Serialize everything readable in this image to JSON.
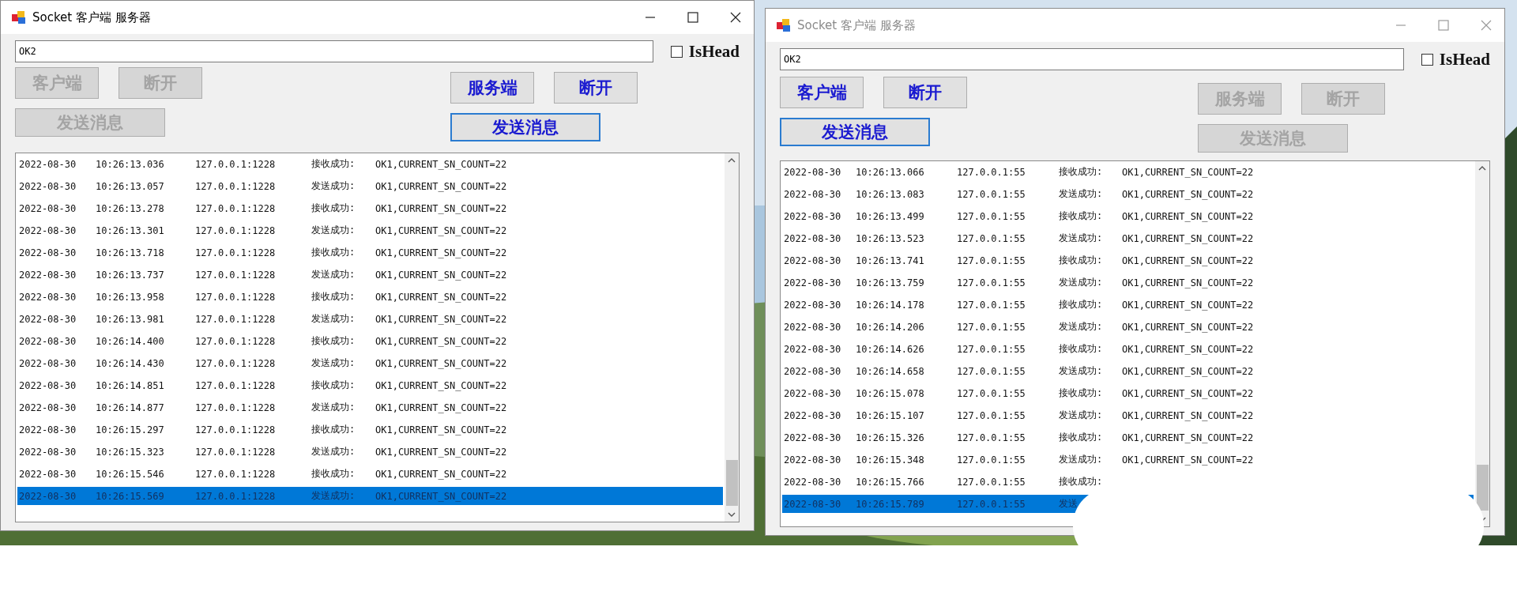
{
  "windows": [
    {
      "title": "Socket 客户端 服务器",
      "active": true,
      "input": {
        "value": "OK2"
      },
      "is_head": {
        "label": "IsHead",
        "checked": false
      },
      "client_buttons": [
        {
          "label": "客户端",
          "disabled": true,
          "focused": false
        },
        {
          "label": "断开",
          "disabled": true,
          "focused": false
        },
        {
          "label": "发送消息",
          "disabled": true,
          "focused": false
        }
      ],
      "server_buttons": [
        {
          "label": "服务端",
          "disabled": false,
          "focused": false
        },
        {
          "label": "断开",
          "disabled": false,
          "focused": false
        },
        {
          "label": "发送消息",
          "disabled": false,
          "focused": true
        }
      ],
      "log": {
        "rows": [
          {
            "cells": [
              "2022-08-30",
              "10:26:13.036",
              "127.0.0.1:1228",
              "接收成功:",
              "OK1,CURRENT_SN_COUNT=22"
            ],
            "selected": false
          },
          {
            "cells": [
              "2022-08-30",
              "10:26:13.057",
              "127.0.0.1:1228",
              "发送成功:",
              "OK1,CURRENT_SN_COUNT=22"
            ],
            "selected": false
          },
          {
            "cells": [
              "2022-08-30",
              "10:26:13.278",
              "127.0.0.1:1228",
              "接收成功:",
              "OK1,CURRENT_SN_COUNT=22"
            ],
            "selected": false
          },
          {
            "cells": [
              "2022-08-30",
              "10:26:13.301",
              "127.0.0.1:1228",
              "发送成功:",
              "OK1,CURRENT_SN_COUNT=22"
            ],
            "selected": false
          },
          {
            "cells": [
              "2022-08-30",
              "10:26:13.718",
              "127.0.0.1:1228",
              "接收成功:",
              "OK1,CURRENT_SN_COUNT=22"
            ],
            "selected": false
          },
          {
            "cells": [
              "2022-08-30",
              "10:26:13.737",
              "127.0.0.1:1228",
              "发送成功:",
              "OK1,CURRENT_SN_COUNT=22"
            ],
            "selected": false
          },
          {
            "cells": [
              "2022-08-30",
              "10:26:13.958",
              "127.0.0.1:1228",
              "接收成功:",
              "OK1,CURRENT_SN_COUNT=22"
            ],
            "selected": false
          },
          {
            "cells": [
              "2022-08-30",
              "10:26:13.981",
              "127.0.0.1:1228",
              "发送成功:",
              "OK1,CURRENT_SN_COUNT=22"
            ],
            "selected": false
          },
          {
            "cells": [
              "2022-08-30",
              "10:26:14.400",
              "127.0.0.1:1228",
              "接收成功:",
              "OK1,CURRENT_SN_COUNT=22"
            ],
            "selected": false
          },
          {
            "cells": [
              "2022-08-30",
              "10:26:14.430",
              "127.0.0.1:1228",
              "发送成功:",
              "OK1,CURRENT_SN_COUNT=22"
            ],
            "selected": false
          },
          {
            "cells": [
              "2022-08-30",
              "10:26:14.851",
              "127.0.0.1:1228",
              "接收成功:",
              "OK1,CURRENT_SN_COUNT=22"
            ],
            "selected": false
          },
          {
            "cells": [
              "2022-08-30",
              "10:26:14.877",
              "127.0.0.1:1228",
              "发送成功:",
              "OK1,CURRENT_SN_COUNT=22"
            ],
            "selected": false
          },
          {
            "cells": [
              "2022-08-30",
              "10:26:15.297",
              "127.0.0.1:1228",
              "接收成功:",
              "OK1,CURRENT_SN_COUNT=22"
            ],
            "selected": false
          },
          {
            "cells": [
              "2022-08-30",
              "10:26:15.323",
              "127.0.0.1:1228",
              "发送成功:",
              "OK1,CURRENT_SN_COUNT=22"
            ],
            "selected": false
          },
          {
            "cells": [
              "2022-08-30",
              "10:26:15.546",
              "127.0.0.1:1228",
              "接收成功:",
              "OK1,CURRENT_SN_COUNT=22"
            ],
            "selected": false
          },
          {
            "cells": [
              "2022-08-30",
              "10:26:15.569",
              "127.0.0.1:1228",
              "发送成功:",
              "OK1,CURRENT_SN_COUNT=22"
            ],
            "selected": true
          }
        ]
      }
    },
    {
      "title": "Socket 客户端 服务器",
      "active": false,
      "input": {
        "value": "OK2"
      },
      "is_head": {
        "label": "IsHead",
        "checked": false
      },
      "client_buttons": [
        {
          "label": "客户端",
          "disabled": false,
          "focused": false
        },
        {
          "label": "断开",
          "disabled": false,
          "focused": false
        },
        {
          "label": "发送消息",
          "disabled": false,
          "focused": true
        }
      ],
      "server_buttons": [
        {
          "label": "服务端",
          "disabled": true,
          "focused": false
        },
        {
          "label": "断开",
          "disabled": true,
          "focused": false
        },
        {
          "label": "发送消息",
          "disabled": true,
          "focused": false
        }
      ],
      "log": {
        "rows": [
          {
            "cells": [
              "2022-08-30",
              "10:26:13.066",
              "127.0.0.1:55",
              "接收成功:",
              "OK1,CURRENT_SN_COUNT=22"
            ],
            "selected": false
          },
          {
            "cells": [
              "2022-08-30",
              "10:26:13.083",
              "127.0.0.1:55",
              "发送成功:",
              "OK1,CURRENT_SN_COUNT=22"
            ],
            "selected": false
          },
          {
            "cells": [
              "2022-08-30",
              "10:26:13.499",
              "127.0.0.1:55",
              "接收成功:",
              "OK1,CURRENT_SN_COUNT=22"
            ],
            "selected": false
          },
          {
            "cells": [
              "2022-08-30",
              "10:26:13.523",
              "127.0.0.1:55",
              "发送成功:",
              "OK1,CURRENT_SN_COUNT=22"
            ],
            "selected": false
          },
          {
            "cells": [
              "2022-08-30",
              "10:26:13.741",
              "127.0.0.1:55",
              "接收成功:",
              "OK1,CURRENT_SN_COUNT=22"
            ],
            "selected": false
          },
          {
            "cells": [
              "2022-08-30",
              "10:26:13.759",
              "127.0.0.1:55",
              "发送成功:",
              "OK1,CURRENT_SN_COUNT=22"
            ],
            "selected": false
          },
          {
            "cells": [
              "2022-08-30",
              "10:26:14.178",
              "127.0.0.1:55",
              "接收成功:",
              "OK1,CURRENT_SN_COUNT=22"
            ],
            "selected": false
          },
          {
            "cells": [
              "2022-08-30",
              "10:26:14.206",
              "127.0.0.1:55",
              "发送成功:",
              "OK1,CURRENT_SN_COUNT=22"
            ],
            "selected": false
          },
          {
            "cells": [
              "2022-08-30",
              "10:26:14.626",
              "127.0.0.1:55",
              "接收成功:",
              "OK1,CURRENT_SN_COUNT=22"
            ],
            "selected": false
          },
          {
            "cells": [
              "2022-08-30",
              "10:26:14.658",
              "127.0.0.1:55",
              "发送成功:",
              "OK1,CURRENT_SN_COUNT=22"
            ],
            "selected": false
          },
          {
            "cells": [
              "2022-08-30",
              "10:26:15.078",
              "127.0.0.1:55",
              "接收成功:",
              "OK1,CURRENT_SN_COUNT=22"
            ],
            "selected": false
          },
          {
            "cells": [
              "2022-08-30",
              "10:26:15.107",
              "127.0.0.1:55",
              "发送成功:",
              "OK1,CURRENT_SN_COUNT=22"
            ],
            "selected": false
          },
          {
            "cells": [
              "2022-08-30",
              "10:26:15.326",
              "127.0.0.1:55",
              "接收成功:",
              "OK1,CURRENT_SN_COUNT=22"
            ],
            "selected": false
          },
          {
            "cells": [
              "2022-08-30",
              "10:26:15.348",
              "127.0.0.1:55",
              "发送成功:",
              "OK1,CURRENT_SN_COUNT=22"
            ],
            "selected": false
          },
          {
            "cells": [
              "2022-08-30",
              "10:26:15.766",
              "127.0.0.1:55",
              "接收成功:"
            ],
            "selected": false
          },
          {
            "cells": [
              "2022-08-30",
              "10:26:15.789",
              "127.0.0.1:55",
              "发送"
            ],
            "selected": true
          }
        ]
      },
      "cover": true
    }
  ]
}
